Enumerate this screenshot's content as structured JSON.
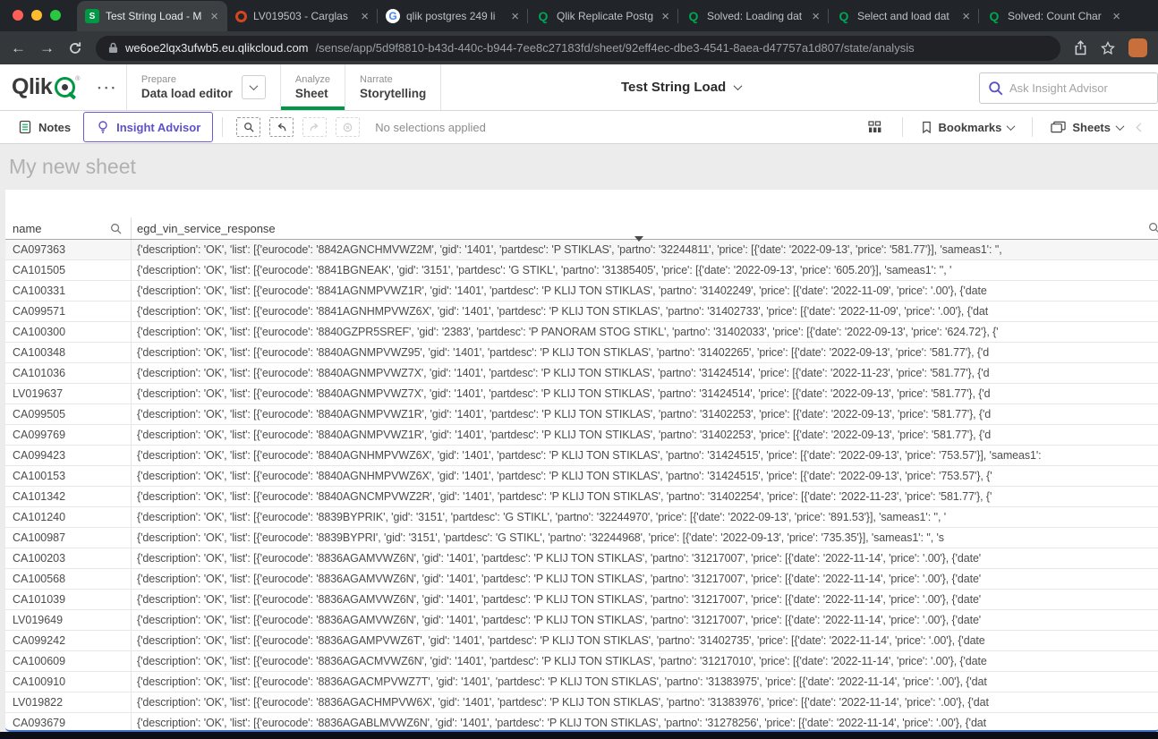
{
  "colors": {
    "qlik_green": "#009845",
    "qlik_purple": "#5e50c8",
    "selection_border_blue": "#3f72c8"
  },
  "browser": {
    "tabs": [
      {
        "title": "Test String Load - M",
        "icon": "qlik-sense",
        "active": true
      },
      {
        "title": "LV019503 - Carglas",
        "icon": "carglass",
        "active": false
      },
      {
        "title": "qlik postgres 249 li",
        "icon": "google",
        "active": false
      },
      {
        "title": "Qlik Replicate Postg",
        "icon": "qlik",
        "active": false
      },
      {
        "title": "Solved: Loading dat",
        "icon": "qlik",
        "active": false
      },
      {
        "title": "Select and load dat",
        "icon": "qlik",
        "active": false
      },
      {
        "title": "Solved: Count Char",
        "icon": "qlik",
        "active": false
      }
    ],
    "back_glyph": "←",
    "forward_glyph": "→",
    "url_domain": "we6oe2lqx3ufwb5.eu.qlikcloud.com",
    "url_path": "/sense/app/5d9f8810-b43d-440c-b944-7ee8c27183fd/sheet/92eff4ec-dbe3-4541-8aea-d47757a1d807/state/analysis"
  },
  "header": {
    "logo_text": "Qlik",
    "logo_reg": "®",
    "more_icon": "• • •",
    "nav": [
      {
        "section": "Prepare",
        "page": "Data load editor"
      },
      {
        "section": "Analyze",
        "page": "Sheet"
      },
      {
        "section": "Narrate",
        "page": "Storytelling"
      }
    ],
    "app_title": "Test String Load",
    "search_placeholder": "Ask Insight Advisor"
  },
  "toolbar": {
    "notes_label": "Notes",
    "insight_advisor_label": "Insight Advisor",
    "no_selections_label": "No selections applied",
    "bookmarks_label": "Bookmarks",
    "sheets_label": "Sheets"
  },
  "sheet": {
    "title": "My new sheet"
  },
  "table": {
    "columns": [
      {
        "label": "name"
      },
      {
        "label": "egd_vin_service_response"
      }
    ],
    "rows": [
      {
        "name": "CA097363",
        "response": "{'description': 'OK', 'list': [{'eurocode': '8842AGNCHMVWZ2M', 'gid': '1401', 'partdesc': 'P STIKLAS', 'partno': '32244811', 'price': [{'date': '2022-09-13', 'price': '581.77'}], 'sameas1': '',"
      },
      {
        "name": "CA101505",
        "response": "{'description': 'OK', 'list': [{'eurocode': '8841BGNEAK', 'gid': '3151', 'partdesc': 'G STIKL', 'partno': '31385405', 'price': [{'date': '2022-09-13', 'price': '605.20'}], 'sameas1': '', '"
      },
      {
        "name": "CA100331",
        "response": "{'description': 'OK', 'list': [{'eurocode': '8841AGNMPVWZ1R', 'gid': '1401', 'partdesc': 'P KLIJ TON STIKLAS', 'partno': '31402249', 'price': [{'date': '2022-11-09', 'price': '.00'}, {'date"
      },
      {
        "name": "CA099571",
        "response": "{'description': 'OK', 'list': [{'eurocode': '8841AGNHMPVWZ6X', 'gid': '1401', 'partdesc': 'P KLIJ TON STIKLAS', 'partno': '31402733', 'price': [{'date': '2022-11-09', 'price': '.00'}, {'dat"
      },
      {
        "name": "CA100300",
        "response": "{'description': 'OK', 'list': [{'eurocode': '8840GZPR5SREF', 'gid': '2383', 'partdesc': 'P PANORAM STOG STIKL', 'partno': '31402033', 'price': [{'date': '2022-09-13', 'price': '624.72'}, {'"
      },
      {
        "name": "CA100348",
        "response": "{'description': 'OK', 'list': [{'eurocode': '8840AGNMPVWZ95', 'gid': '1401', 'partdesc': 'P KLIJ TON STIKLAS', 'partno': '31402265', 'price': [{'date': '2022-09-13', 'price': '581.77'}, {'d"
      },
      {
        "name": "CA101036",
        "response": "{'description': 'OK', 'list': [{'eurocode': '8840AGNMPVWZ7X', 'gid': '1401', 'partdesc': 'P KLIJ TON STIKLAS', 'partno': '31424514', 'price': [{'date': '2022-11-23', 'price': '581.77'}, {'d"
      },
      {
        "name": "LV019637",
        "response": "{'description': 'OK', 'list': [{'eurocode': '8840AGNMPVWZ7X', 'gid': '1401', 'partdesc': 'P KLIJ TON STIKLAS', 'partno': '31424514', 'price': [{'date': '2022-09-13', 'price': '581.77'}, {'d"
      },
      {
        "name": "CA099505",
        "response": "{'description': 'OK', 'list': [{'eurocode': '8840AGNMPVWZ1R', 'gid': '1401', 'partdesc': 'P KLIJ TON STIKLAS', 'partno': '31402253', 'price': [{'date': '2022-09-13', 'price': '581.77'}, {'d"
      },
      {
        "name": "CA099769",
        "response": "{'description': 'OK', 'list': [{'eurocode': '8840AGNMPVWZ1R', 'gid': '1401', 'partdesc': 'P KLIJ TON STIKLAS', 'partno': '31402253', 'price': [{'date': '2022-09-13', 'price': '581.77'}, {'d"
      },
      {
        "name": "CA099423",
        "response": "{'description': 'OK', 'list': [{'eurocode': '8840AGNHMPVWZ6X', 'gid': '1401', 'partdesc': 'P KLIJ TON STIKLAS', 'partno': '31424515', 'price': [{'date': '2022-09-13', 'price': '753.57'}], 'sameas1':"
      },
      {
        "name": "CA100153",
        "response": "{'description': 'OK', 'list': [{'eurocode': '8840AGNHMPVWZ6X', 'gid': '1401', 'partdesc': 'P KLIJ TON STIKLAS', 'partno': '31424515', 'price': [{'date': '2022-09-13', 'price': '753.57'}, {'"
      },
      {
        "name": "CA101342",
        "response": "{'description': 'OK', 'list': [{'eurocode': '8840AGNCMPVWZ2R', 'gid': '1401', 'partdesc': 'P KLIJ TON STIKLAS', 'partno': '31402254', 'price': [{'date': '2022-11-23', 'price': '581.77'}, {'"
      },
      {
        "name": "CA101240",
        "response": "{'description': 'OK', 'list': [{'eurocode': '8839BYPRIK', 'gid': '3151', 'partdesc': 'G STIKL', 'partno': '32244970', 'price': [{'date': '2022-09-13', 'price': '891.53'}], 'sameas1': '', '"
      },
      {
        "name": "CA100987",
        "response": "{'description': 'OK', 'list': [{'eurocode': '8839BYPRI', 'gid': '3151', 'partdesc': 'G STIKL', 'partno': '32244968', 'price': [{'date': '2022-09-13', 'price': '735.35'}], 'sameas1': '', 's"
      },
      {
        "name": "CA100203",
        "response": "{'description': 'OK', 'list': [{'eurocode': '8836AGAMVWZ6N', 'gid': '1401', 'partdesc': 'P KLIJ TON STIKLAS', 'partno': '31217007', 'price': [{'date': '2022-11-14', 'price': '.00'}, {'date'"
      },
      {
        "name": "CA100568",
        "response": "{'description': 'OK', 'list': [{'eurocode': '8836AGAMVWZ6N', 'gid': '1401', 'partdesc': 'P KLIJ TON STIKLAS', 'partno': '31217007', 'price': [{'date': '2022-11-14', 'price': '.00'}, {'date'"
      },
      {
        "name": "CA101039",
        "response": "{'description': 'OK', 'list': [{'eurocode': '8836AGAMVWZ6N', 'gid': '1401', 'partdesc': 'P KLIJ TON STIKLAS', 'partno': '31217007', 'price': [{'date': '2022-11-14', 'price': '.00'}, {'date'"
      },
      {
        "name": "LV019649",
        "response": "{'description': 'OK', 'list': [{'eurocode': '8836AGAMVWZ6N', 'gid': '1401', 'partdesc': 'P KLIJ TON STIKLAS', 'partno': '31217007', 'price': [{'date': '2022-11-14', 'price': '.00'}, {'date'"
      },
      {
        "name": "CA099242",
        "response": "{'description': 'OK', 'list': [{'eurocode': '8836AGAMPVWZ6T', 'gid': '1401', 'partdesc': 'P KLIJ TON STIKLAS', 'partno': '31402735', 'price': [{'date': '2022-11-14', 'price': '.00'}, {'date"
      },
      {
        "name": "CA100609",
        "response": "{'description': 'OK', 'list': [{'eurocode': '8836AGACMVWZ6N', 'gid': '1401', 'partdesc': 'P KLIJ TON STIKLAS', 'partno': '31217010', 'price': [{'date': '2022-11-14', 'price': '.00'}, {'date"
      },
      {
        "name": "CA100910",
        "response": "{'description': 'OK', 'list': [{'eurocode': '8836AGACMPVWZ7T', 'gid': '1401', 'partdesc': 'P KLIJ TON STIKLAS', 'partno': '31383975', 'price': [{'date': '2022-11-14', 'price': '.00'}, {'dat"
      },
      {
        "name": "LV019822",
        "response": "{'description': 'OK', 'list': [{'eurocode': '8836AGACHMPVW6X', 'gid': '1401', 'partdesc': 'P KLIJ TON STIKLAS', 'partno': '31383976', 'price': [{'date': '2022-11-14', 'price': '.00'}, {'dat"
      },
      {
        "name": "CA093679",
        "response": "{'description': 'OK', 'list': [{'eurocode': '8836AGABLMVWZ6N', 'gid': '1401', 'partdesc': 'P KLIJ TON STIKLAS', 'partno': '31278256', 'price': [{'date': '2022-11-14', 'price': '.00'}, {'dat"
      }
    ]
  }
}
